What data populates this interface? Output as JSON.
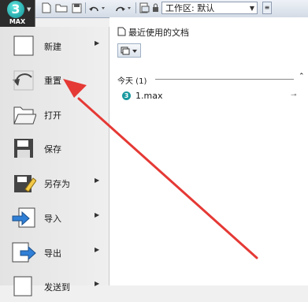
{
  "app": {
    "logo_digit": "3",
    "logo_text": "MAX"
  },
  "toolbar": {
    "icons": [
      "new-file-icon",
      "open-folder-icon",
      "save-icon",
      "undo-icon",
      "redo-icon",
      "project-folder-icon"
    ],
    "workspace_label": "工作区: 默认"
  },
  "menu": {
    "items": [
      {
        "label": "新建",
        "submenu": true,
        "icon": "new-document-icon"
      },
      {
        "label": "重置",
        "submenu": false,
        "icon": "reset-icon"
      },
      {
        "label": "打开",
        "submenu": false,
        "icon": "open-folder-icon"
      },
      {
        "label": "保存",
        "submenu": false,
        "icon": "floppy-icon"
      },
      {
        "label": "另存为",
        "submenu": true,
        "icon": "save-as-icon"
      },
      {
        "label": "导入",
        "submenu": true,
        "icon": "import-icon"
      },
      {
        "label": "导出",
        "submenu": true,
        "icon": "export-icon"
      },
      {
        "label": "发送到",
        "submenu": true,
        "icon": "send-to-icon"
      }
    ],
    "submenu_glyph": "▶"
  },
  "recent": {
    "title": "最近使用的文档",
    "group_label": "今天 (1)",
    "files": [
      {
        "name": "1.max",
        "icon": "max-file-icon"
      }
    ]
  },
  "colors": {
    "annotation_arrow": "#e53935",
    "accent": "#1a9aa0"
  }
}
